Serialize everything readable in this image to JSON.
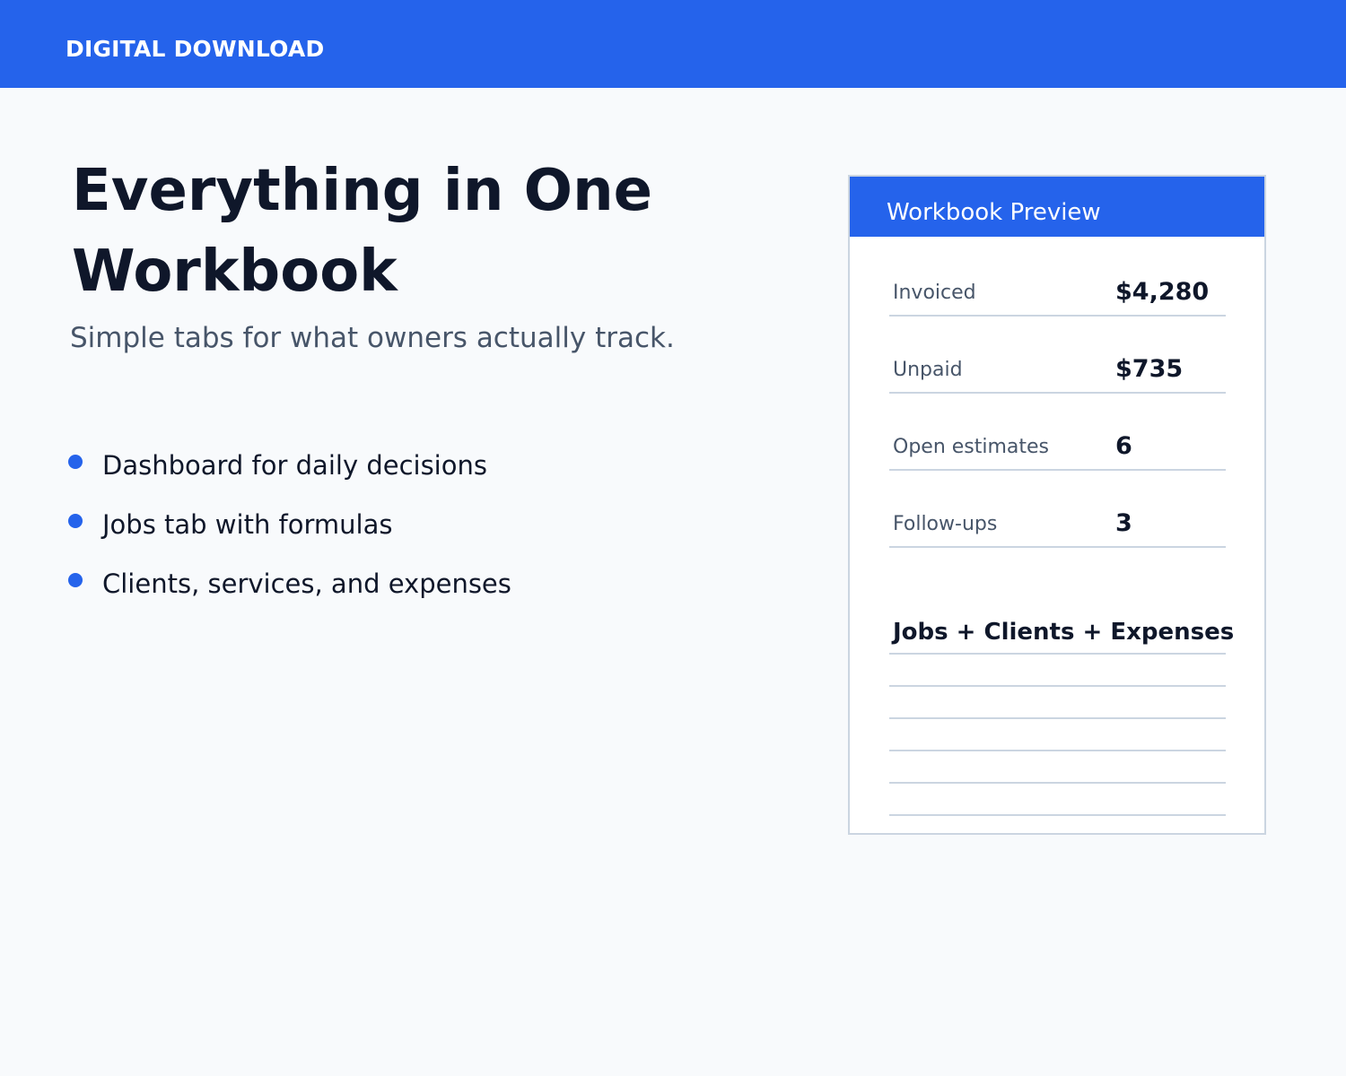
{
  "banner": {
    "label": "DIGITAL DOWNLOAD",
    "color": "#2563eb"
  },
  "hero": {
    "title_line1": "Everything in One",
    "title_line2": "Workbook",
    "subtitle": "Simple tabs for what owners actually track."
  },
  "features": [
    {
      "label": "Dashboard for daily decisions"
    },
    {
      "label": "Jobs tab with formulas"
    },
    {
      "label": "Clients, services, and expenses"
    }
  ],
  "preview": {
    "title": "Workbook Preview",
    "metrics": [
      {
        "label": "Invoiced",
        "value": "$4,280"
      },
      {
        "label": "Unpaid",
        "value": "$735"
      },
      {
        "label": "Open estimates",
        "value": "6"
      },
      {
        "label": "Follow-ups",
        "value": "3"
      }
    ],
    "tabs_heading": "Jobs + Clients + Expenses"
  }
}
